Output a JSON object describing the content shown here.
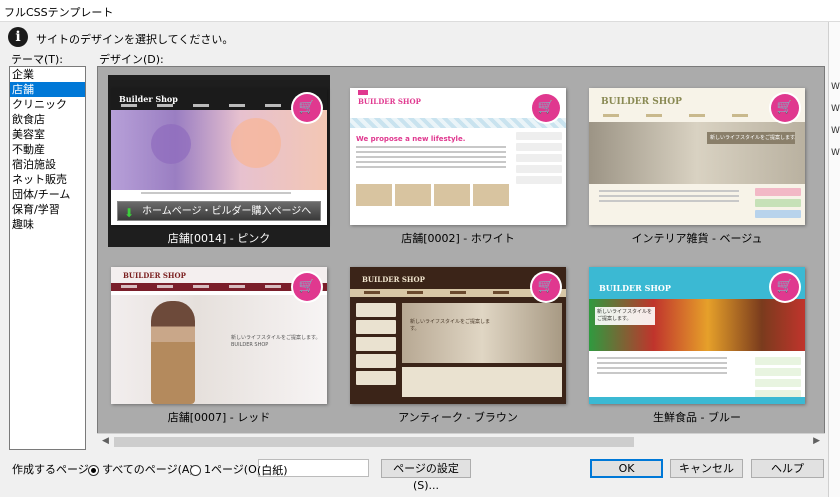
{
  "window": {
    "title": "フルCSSテンプレート"
  },
  "message": "サイトのデザインを選択してください。",
  "theme_label": "テーマ(T):",
  "design_label": "デザイン(D):",
  "themes": [
    "企業",
    "店舗",
    "クリニック",
    "飲食店",
    "美容室",
    "不動産",
    "宿泊施設",
    "ネット販売",
    "団体/チーム",
    "保育/学習",
    "趣味"
  ],
  "selected_theme": "店舗",
  "designs": [
    {
      "caption": "店舗[0014] - ピンク",
      "brand": "Builder Shop",
      "selected": true
    },
    {
      "caption": "店舗[0002] - ホワイト",
      "brand": "BUILDER SHOP",
      "tagline": "We propose a new lifestyle."
    },
    {
      "caption": "インテリア雑貨 - ベージュ",
      "brand": "BUILDER SHOP",
      "tagline": "新しいライフスタイルをご提案します。"
    },
    {
      "caption": "店舗[0007] - レッド",
      "brand": "BUILDER SHOP",
      "tagline": "新しいライフスタイルをご提案します。 BUILDER SHOP"
    },
    {
      "caption": "アンティーク - ブラウン",
      "brand": "BUILDER SHOP",
      "tagline": "新しいライフスタイルをご提案します。"
    },
    {
      "caption": "生鮮食品 - ブルー",
      "brand": "BUILDER SHOP",
      "tagline": "新しいライフスタイルをご提案します。"
    }
  ],
  "hp_button": "ホームページ・ビルダー購入ページへ",
  "bottom": {
    "pages_label": "作成するページ:",
    "radio_all": "すべてのページ(A)",
    "radio_one": "1ページ(O)",
    "one_value": "(白紙)",
    "page_settings": "ページの設定(S)...",
    "ok": "OK",
    "cancel": "キャンセル",
    "help": "ヘルプ"
  },
  "right_strip": [
    "W",
    "W",
    "W",
    "W"
  ],
  "colors": {
    "accent": "#0078d7",
    "cart": "#e0388f",
    "gallery_bg": "#ababab"
  }
}
